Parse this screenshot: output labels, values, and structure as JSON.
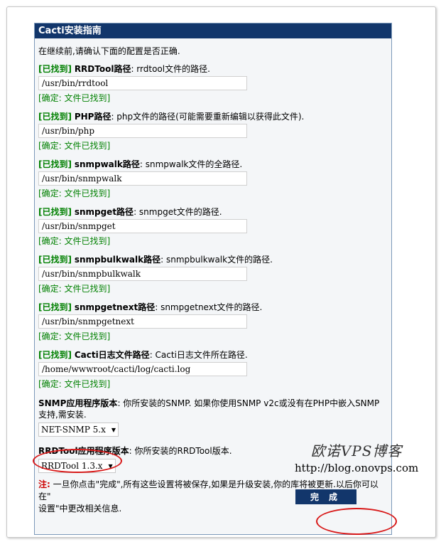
{
  "panel": {
    "title": "Cacti安装指南",
    "intro": "在继续前,请确认下面的配置是否正确."
  },
  "paths": [
    {
      "found": "[已找到]",
      "name": "RRDTool路径",
      "desc": ": rrdtool文件的路径.",
      "value": "/usr/bin/rrdtool",
      "confirm": "[确定: 文件已找到]"
    },
    {
      "found": "[已找到]",
      "name": "PHP路径",
      "desc": ": php文件的路径(可能需要重新编辑以获得此文件).",
      "value": "/usr/bin/php",
      "confirm": "[确定: 文件已找到]"
    },
    {
      "found": "[已找到]",
      "name": "snmpwalk路径",
      "desc": ": snmpwalk文件的全路径.",
      "value": "/usr/bin/snmpwalk",
      "confirm": "[确定: 文件已找到]"
    },
    {
      "found": "[已找到]",
      "name": "snmpget路径",
      "desc": ": snmpget文件的路径.",
      "value": "/usr/bin/snmpget",
      "confirm": "[确定: 文件已找到]"
    },
    {
      "found": "[已找到]",
      "name": "snmpbulkwalk路径",
      "desc": ": snmpbulkwalk文件的路径.",
      "value": "/usr/bin/snmpbulkwalk",
      "confirm": "[确定: 文件已找到]"
    },
    {
      "found": "[已找到]",
      "name": "snmpgetnext路径",
      "desc": ": snmpgetnext文件的路径.",
      "value": "/usr/bin/snmpgetnext",
      "confirm": "[确定: 文件已找到]"
    },
    {
      "found": "[已找到]",
      "name": "Cacti日志文件路径",
      "desc": ": Cacti日志文件所在路径.",
      "value": "/home/wwwroot/cacti/log/cacti.log",
      "confirm": "[确定: 文件已找到]"
    }
  ],
  "snmp": {
    "name": "SNMP应用程序版本",
    "desc_line1": ": 你所安装的SNMP. 如果你使用SNMP v2c或没有在PHP中嵌入SNMP",
    "desc_line2": "支持,需安装.",
    "selected": "NET-SNMP 5.x"
  },
  "rrd": {
    "name": "RRDTool应用程序版本",
    "desc": ": 你所安装的RRDTool版本.",
    "selected": "RRDTool 1.3.x"
  },
  "note": {
    "label": "注:",
    "line1": " 一旦你点击\"完成\",所有这些设置将被保存,如果是升级安装,你的库将被更新.以后你可以在\"",
    "line2": "设置\"中更改相关信息."
  },
  "finish_button": "完成",
  "watermark": {
    "title": "欧诺VPS博客",
    "url": "http://blog.onovps.com"
  },
  "colors": {
    "header_bg": "#12366b",
    "found_green": "#008000",
    "warn_red": "#cc0000",
    "highlight_oval": "#d81818"
  }
}
